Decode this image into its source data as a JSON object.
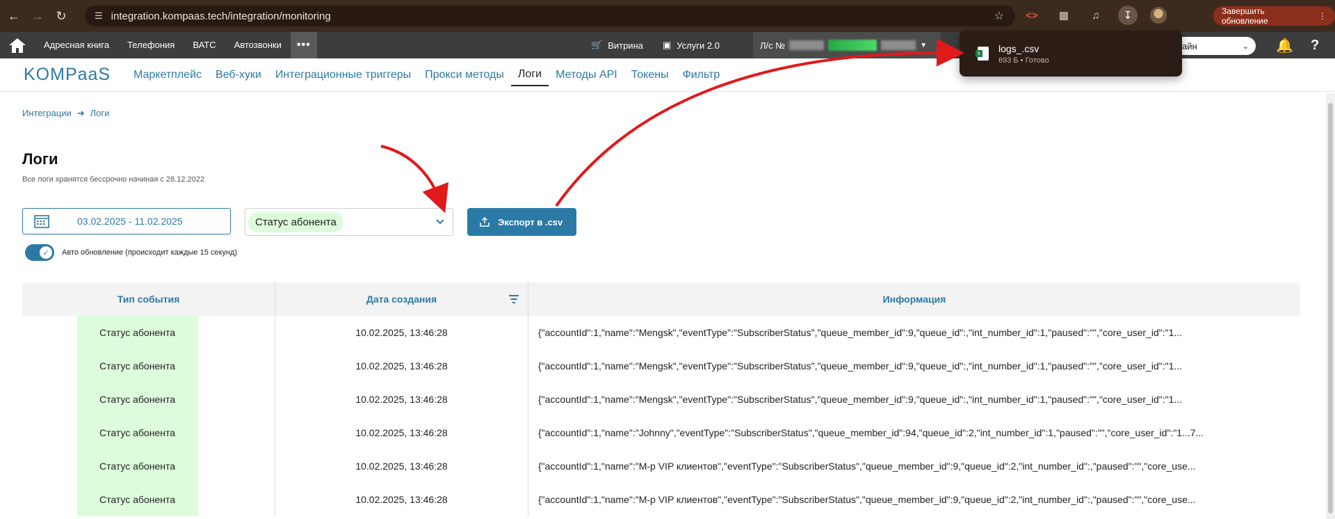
{
  "browser": {
    "url": "integration.kompaas.tech/integration/monitoring",
    "update_label": "Завершить обновление"
  },
  "topbar": {
    "items": [
      "Адресная книга",
      "Телефония",
      "ВАТС",
      "Автозвонки"
    ],
    "more": "•••",
    "vitrina": "Витрина",
    "services": "Услуги 2.0",
    "account_prefix": "Л/с №",
    "select_value": "айн"
  },
  "appnav": {
    "logo": "KOMPaaS",
    "items": [
      "Маркетплейс",
      "Веб-хуки",
      "Интеграционные триггеры",
      "Прокси методы",
      "Логи",
      "Методы API",
      "Токены",
      "Фильтр"
    ],
    "active": "Логи"
  },
  "download": {
    "file_name": "logs_.csv",
    "meta": "693 Б • Готово"
  },
  "breadcrumb": [
    "Интеграции",
    "Логи"
  ],
  "page": {
    "title": "Логи",
    "subtitle": "Все логи хранятся бессрочно начиная с 28.12.2022"
  },
  "filters": {
    "date_range": "03.02.2025 - 11.02.2025",
    "status_value": "Статус абонента",
    "export_label": "Экспорт в .csv",
    "auto_update_label": "Авто обновление (происходит каждые 15 секунд)"
  },
  "table": {
    "headers": [
      "Тип события",
      "Дата создания",
      "Информация"
    ],
    "rows": [
      {
        "type": "Статус абонента",
        "date": "10.02.2025, 13:46:28",
        "info": "{\"accountId\":1,\"name\":\"Mengsk\",\"eventType\":\"SubscriberStatus\",\"queue_member_id\":9,\"queue_id\":,\"int_number_id\":1,\"paused\":\"\",\"core_user_id\":\"1..."
      },
      {
        "type": "Статус абонента",
        "date": "10.02.2025, 13:46:28",
        "info": "{\"accountId\":1,\"name\":\"Mengsk\",\"eventType\":\"SubscriberStatus\",\"queue_member_id\":9,\"queue_id\":,\"int_number_id\":1,\"paused\":\"\",\"core_user_id\":\"1..."
      },
      {
        "type": "Статус абонента",
        "date": "10.02.2025, 13:46:28",
        "info": "{\"accountId\":1,\"name\":\"Mengsk\",\"eventType\":\"SubscriberStatus\",\"queue_member_id\":9,\"queue_id\":,\"int_number_id\":1,\"paused\":\"\",\"core_user_id\":\"1..."
      },
      {
        "type": "Статус абонента",
        "date": "10.02.2025, 13:46:28",
        "info": "{\"accountId\":1,\"name\":\"Johnny\",\"eventType\":\"SubscriberStatus\",\"queue_member_id\":94,\"queue_id\":2,\"int_number_id\":1,\"paused\":\"\",\"core_user_id\":\"1...7..."
      },
      {
        "type": "Статус абонента",
        "date": "10.02.2025, 13:46:28",
        "info": "{\"accountId\":1,\"name\":\"М-р VIP клиентов\",\"eventType\":\"SubscriberStatus\",\"queue_member_id\":9,\"queue_id\":2,\"int_number_id\":,\"paused\":\"\",\"core_use..."
      },
      {
        "type": "Статус абонента",
        "date": "10.02.2025, 13:46:28",
        "info": "{\"accountId\":1,\"name\":\"М-р VIP клиентов\",\"eventType\":\"SubscriberStatus\",\"queue_member_id\":9,\"queue_id\":2,\"int_number_id\":,\"paused\":\"\",\"core_use..."
      }
    ]
  },
  "colors": {
    "accent": "#2b7aa6",
    "badge_bg": "#dcfcdc",
    "arrow": "#e0191b"
  }
}
